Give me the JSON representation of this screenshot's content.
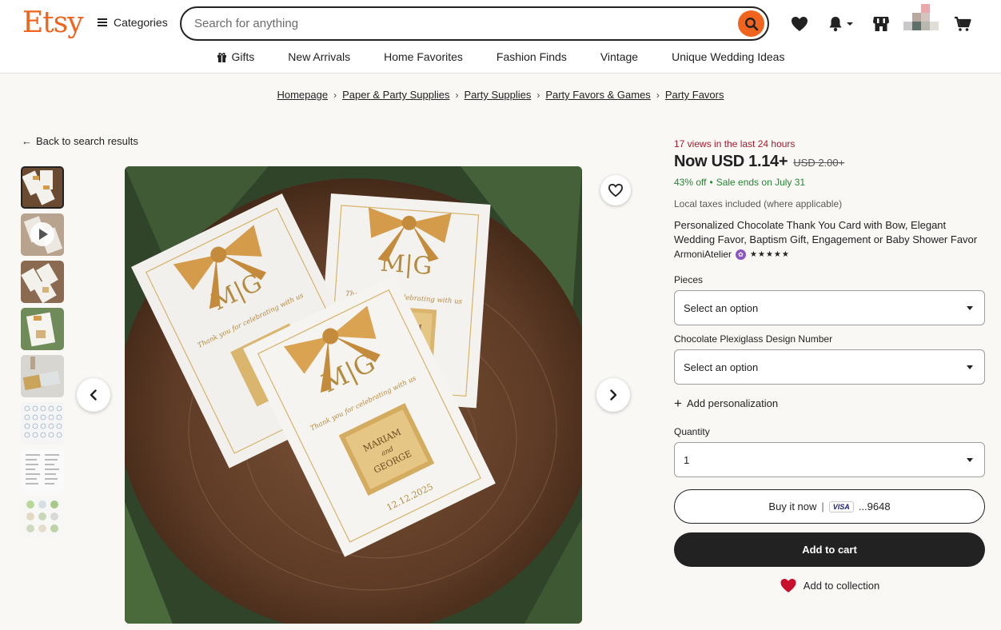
{
  "header": {
    "logo": "Etsy",
    "categories_label": "Categories",
    "search_placeholder": "Search for anything"
  },
  "nav": [
    {
      "label": "Gifts",
      "icon": "gift-icon"
    },
    {
      "label": "New Arrivals"
    },
    {
      "label": "Home Favorites"
    },
    {
      "label": "Fashion Finds"
    },
    {
      "label": "Vintage"
    },
    {
      "label": "Unique Wedding Ideas"
    }
  ],
  "breadcrumb": [
    "Homepage",
    "Paper & Party Supplies",
    "Party Supplies",
    "Party Favors & Games",
    "Party Favors"
  ],
  "back_link": "Back to search results",
  "image": {
    "card_monogram": "M|G",
    "card_script": "Thank you for celebrating with us",
    "chocolate_name_1": "MARIAM",
    "chocolate_and": "and",
    "chocolate_name_2": "GEORGE",
    "card_date": "12.12.2025"
  },
  "product": {
    "views": "17 views in the last 24 hours",
    "price": "Now USD 1.14+",
    "old_price": "USD 2.00+",
    "discount": "43% off",
    "sale_ends": "Sale ends on July 31",
    "taxes": "Local taxes included (where applicable)",
    "title": "Personalized Chocolate Thank You Card with Bow, Elegant Wedding Favor, Baptism Gift, Engagement or Baby Shower Favor",
    "shop": "ArmoniAtelier",
    "rating": 5
  },
  "options": {
    "pieces_label": "Pieces",
    "pieces_value": "Select an option",
    "design_label": "Chocolate Plexiglass Design Number",
    "design_value": "Select an option",
    "add_personalization": "Add personalization",
    "quantity_label": "Quantity",
    "quantity_value": "1"
  },
  "actions": {
    "buy_now": "Buy it now",
    "buy_sep": "|",
    "card_brand": "VISA",
    "card_last4": "...9648",
    "add_to_cart": "Add to cart",
    "add_to_collection": "Add to collection"
  },
  "colors": {
    "brand": "#f1641e",
    "views_red": "#a61a2e",
    "sale_green": "#258635",
    "dark": "#222222"
  }
}
